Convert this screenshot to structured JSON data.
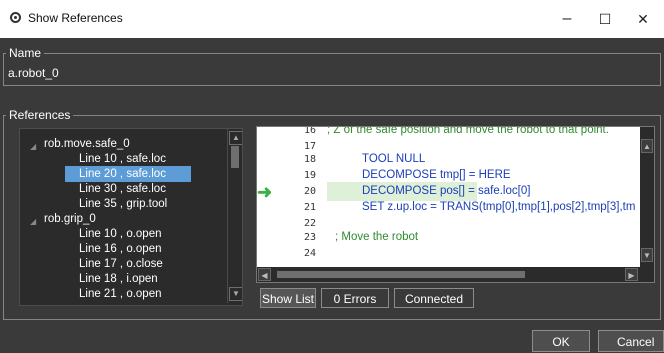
{
  "window": {
    "title": "Show References",
    "minimize": "–",
    "maximize": "☐",
    "close": "✕"
  },
  "name_group": {
    "legend": "Name",
    "value": "a.robot_0"
  },
  "references_group": {
    "legend": "References"
  },
  "tree": [
    {
      "type": "parent",
      "label": "rob.move.safe_0"
    },
    {
      "type": "child",
      "label": "Line 10 ,  safe.loc",
      "selected": false
    },
    {
      "type": "child",
      "label": "Line 20 ,  safe.loc",
      "selected": true
    },
    {
      "type": "child",
      "label": "Line 30 ,  safe.loc",
      "selected": false
    },
    {
      "type": "child",
      "label": "Line 35 ,  grip.tool",
      "selected": false
    },
    {
      "type": "parent",
      "label": "rob.grip_0"
    },
    {
      "type": "child",
      "label": "Line 10 ,  o.open",
      "selected": false
    },
    {
      "type": "child",
      "label": "Line 16 ,  o.open",
      "selected": false
    },
    {
      "type": "child",
      "label": "Line 17 ,  o.close",
      "selected": false
    },
    {
      "type": "child",
      "label": "Line 18 ,  i.open",
      "selected": false
    },
    {
      "type": "child",
      "label": "Line 21 ,  o.open",
      "selected": false
    }
  ],
  "code": {
    "current_line": "20",
    "lines": [
      {
        "num": "16",
        "text": "; Z of the safe position and move the robot to that point."
      },
      {
        "num": "17",
        "text": ""
      },
      {
        "num": "18",
        "text": "TOOL NULL"
      },
      {
        "num": "19",
        "text": "DECOMPOSE tmp[] = HERE"
      },
      {
        "num": "20",
        "text": "DECOMPOSE pos[] = safe.loc[0]"
      },
      {
        "num": "21",
        "text": "SET z.up.loc = TRANS(tmp[0],tmp[1],pos[2],tmp[3],tm"
      },
      {
        "num": "22",
        "text": ""
      },
      {
        "num": "23",
        "text": "; Move the robot"
      },
      {
        "num": "24",
        "text": ""
      }
    ]
  },
  "status": {
    "show_list": "Show List",
    "errors": "0 Errors",
    "connection": "Connected"
  },
  "buttons": {
    "ok": "OK",
    "cancel": "Cancel"
  },
  "colors": {
    "background": "#3a3a3a",
    "selection": "#5d9cd6",
    "keyword": "#1b3fb5",
    "comment": "#2e8b2e",
    "current_arrow": "#3cb043"
  }
}
